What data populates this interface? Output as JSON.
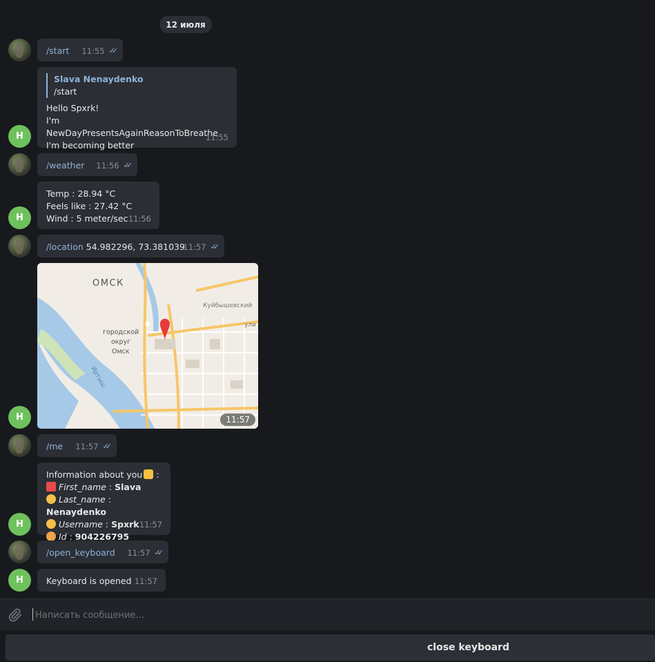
{
  "date_badge": "12 июля",
  "bot_avatar_letter": "Н",
  "messages": {
    "m1": {
      "text": "/start",
      "time": "11:55"
    },
    "m2": {
      "reply_name": "Slava Nenaydenko",
      "reply_text": "/start",
      "line1": "Hello Spxrk!",
      "line2": "I'm NewDayPresentsAgainReasonToBreathe",
      "line3": "I'm becoming better",
      "time": "11:55"
    },
    "m3": {
      "text": "/weather",
      "time": "11:56"
    },
    "m4": {
      "line1": "Temp : 28.94 °C",
      "line2": "Feels like : 27.42 °C",
      "line3": "Wind : 5 meter/sec",
      "time": "11:56"
    },
    "m5": {
      "cmd": "/location",
      "coords": "54.982296, 73.381039",
      "time": "11:57"
    },
    "m6": {
      "map_city": "ОМСК",
      "map_district": "Куйбышевский",
      "map_district2_l1": "городской",
      "map_district2_l2": "округ",
      "map_district2_l3": "Омск",
      "map_river": "Иртыш",
      "map_street": "ули",
      "time": "11:57"
    },
    "m7": {
      "text": "/me",
      "time": "11:57"
    },
    "m8": {
      "header": "Information about you",
      "first_label": "First_name",
      "first_value": "Slava",
      "last_label": "Last_name",
      "last_value": "Nenaydenko",
      "user_label": "Username",
      "user_value": "Spxrk",
      "id_label": "Id",
      "id_value": "904226795",
      "time": "11:57"
    },
    "m9": {
      "text": "/open_keyboard",
      "time": "11:57"
    },
    "m10": {
      "text": "Keyboard is opened",
      "time": "11:57"
    }
  },
  "composer": {
    "placeholder": "Написать сообщение..."
  },
  "keyboard": {
    "button_label": "close keyboard"
  },
  "colors": {
    "accent": "#8fb3d9",
    "bot_avatar": "#6ec15d",
    "bubble": "#2b2e34",
    "background": "#17191d"
  }
}
